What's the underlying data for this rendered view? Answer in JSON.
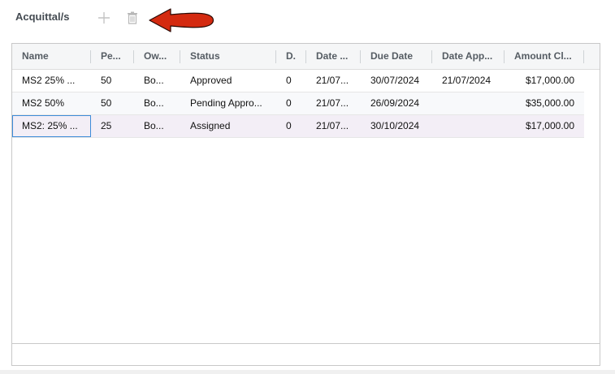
{
  "toolbar": {
    "title": "Acquittal/s",
    "add_icon": "plus-icon",
    "delete_icon": "trash-icon",
    "annotation": "red-arrow"
  },
  "grid": {
    "columns": [
      {
        "label": "Name"
      },
      {
        "label": "Pe..."
      },
      {
        "label": "Ow..."
      },
      {
        "label": "Status"
      },
      {
        "label": "D."
      },
      {
        "label": "Date ..."
      },
      {
        "label": "Due Date"
      },
      {
        "label": "Date App..."
      },
      {
        "label": "Amount Cl..."
      }
    ],
    "rows": [
      {
        "name": "MS2 25% ...",
        "pe": "50",
        "owner": "Bo...",
        "status": "Approved",
        "d": "0",
        "date": "21/07...",
        "due": "30/07/2024",
        "approved": "21/07/2024",
        "amount": "$17,000.00"
      },
      {
        "name": "MS2 50%",
        "pe": "50",
        "owner": "Bo...",
        "status": "Pending Appro...",
        "d": "0",
        "date": "21/07...",
        "due": "26/09/2024",
        "approved": "",
        "amount": "$35,000.00"
      },
      {
        "name": "MS2: 25% ...",
        "pe": "25",
        "owner": "Bo...",
        "status": "Assigned",
        "d": "0",
        "date": "21/07...",
        "due": "30/10/2024",
        "approved": "",
        "amount": "$17,000.00"
      }
    ]
  },
  "colors": {
    "arrow": "#d42a10",
    "selected_row": "#f3eef6",
    "focus": "#3d8bd8"
  }
}
